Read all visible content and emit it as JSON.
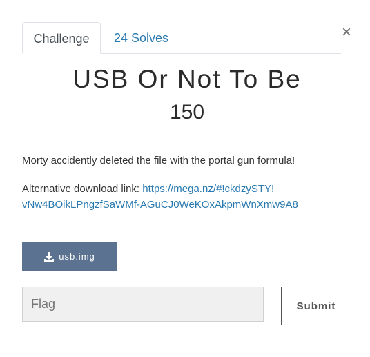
{
  "modal": {
    "close_glyph": "×"
  },
  "tabs": {
    "challenge_label": "Challenge",
    "solves_label": "24 Solves"
  },
  "challenge": {
    "name": "USB Or Not To Be",
    "points": "150",
    "description": "Morty accidently deleted the file with the portal gun formula!",
    "alt_download_prefix": "Alternative download link: ",
    "alt_download_link_line1": "https://mega.nz/#!ckdzySTY!",
    "alt_download_link_line2": "vNw4BOikLPngzfSaWMf-AGuCJ0WeKOxAkpmWnXmw9A8"
  },
  "files": {
    "download_label": "usb.img",
    "download_icon": "download-icon"
  },
  "submission": {
    "flag_placeholder": "Flag",
    "flag_value": "",
    "submit_label": "Submit"
  },
  "colors": {
    "link": "#2a7ab0",
    "download_button_bg": "#5b7290",
    "title_text": "#2b2b2b"
  }
}
